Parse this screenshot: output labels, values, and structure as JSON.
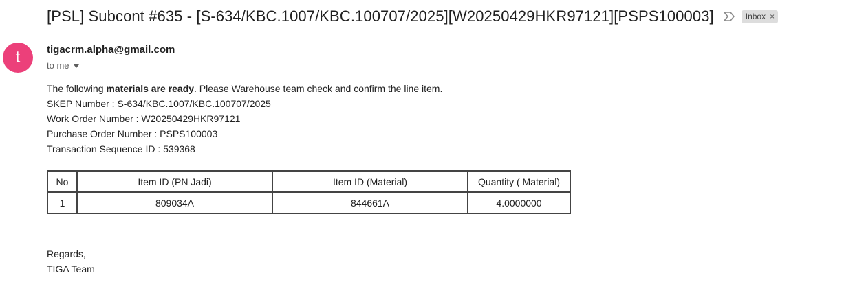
{
  "email": {
    "subject": "[PSL] Subcont #635 - [S-634/KBC.1007/KBC.100707/2025][W20250429HKR97121][PSPS100003]",
    "label": "Inbox",
    "label_close": "×",
    "importance_icon": "importance-marker-icon",
    "avatar_letter": "t",
    "avatar_color": "#ec407a",
    "sender": "tigacrm.alpha@gmail.com",
    "recipient": "to me"
  },
  "body": {
    "intro_before": "The following ",
    "intro_bold": "materials are ready",
    "intro_after": ". Please Warehouse team check and confirm the line item.",
    "skep": "SKEP Number : S-634/KBC.1007/KBC.100707/2025",
    "work_order": "Work Order Number : W20250429HKR97121",
    "purchase_order": "Purchase Order Number : PSPS100003",
    "transaction": "Transaction Sequence ID : 539368"
  },
  "table": {
    "headers": [
      "No",
      "Item ID (PN Jadi)",
      "Item ID (Material)",
      "Quantity ( Material)"
    ],
    "rows": [
      [
        "1",
        "809034A",
        "844661A",
        "4.0000000"
      ]
    ]
  },
  "footer": {
    "regards": "Regards,",
    "team": "TIGA Team"
  }
}
